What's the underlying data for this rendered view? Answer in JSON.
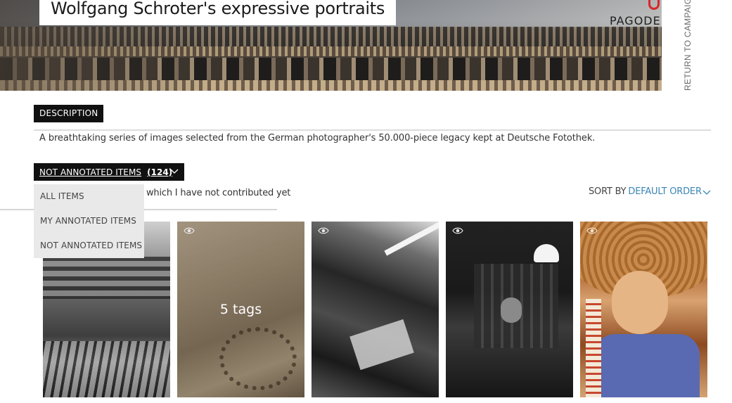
{
  "header": {
    "title": "Wolfgang Schroter's expressive portraits",
    "logo_text": "PAGODE",
    "return_link": "RETURN TO CAMPAIGNS"
  },
  "description": {
    "tab_label": "DESCRIPTION",
    "text": "A breathtaking series of images selected from the German photographer's 50.000-piece legacy kept at Deutsche Fotothek."
  },
  "filter": {
    "selected_label": "NOT ANNOTATED ITEMS",
    "selected_count": "(124)",
    "hint": "which I have not contributed yet",
    "options": [
      "ALL ITEMS",
      "MY ANNOTATED ITEMS",
      "NOT ANNOTATED ITEMS"
    ]
  },
  "sort": {
    "label": "SORT BY",
    "value": "DEFAULT ORDER"
  },
  "items": [
    {
      "overlay": ""
    },
    {
      "overlay": "5 tags"
    },
    {
      "overlay": ""
    },
    {
      "overlay": ""
    },
    {
      "overlay": ""
    }
  ],
  "colors": {
    "accent": "#3b86b5",
    "tab_bg": "#111111",
    "dropdown_bg": "#e9e9e9",
    "brand_red": "#d9262a"
  },
  "icons": {
    "item_view": "eye-icon",
    "dropdown": "chevron-down-icon"
  }
}
